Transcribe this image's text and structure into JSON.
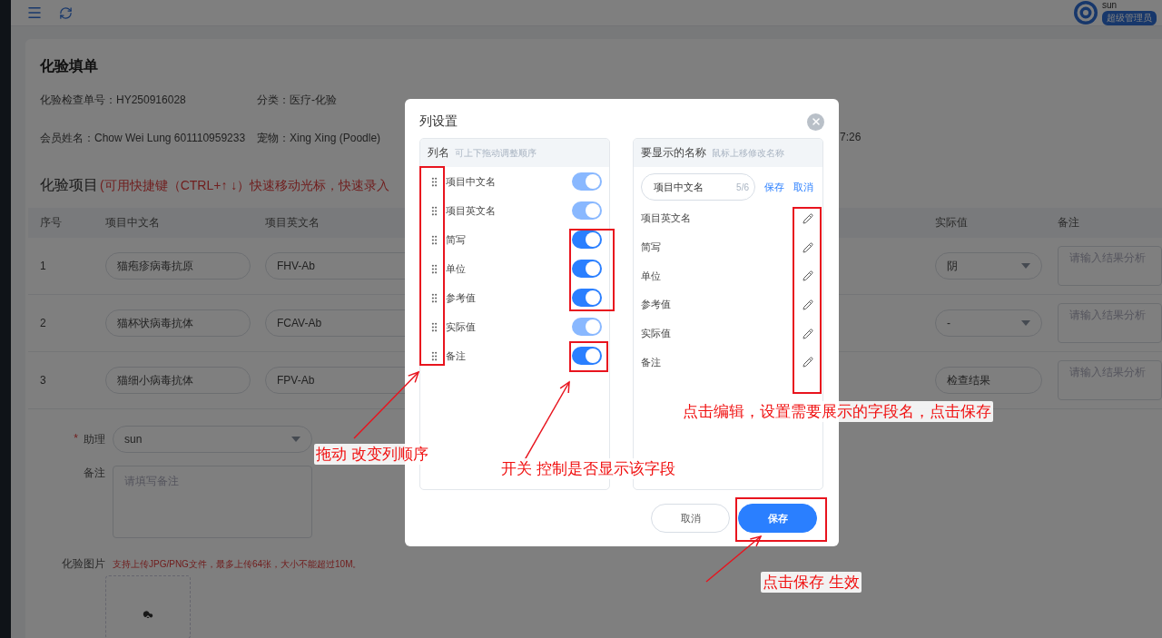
{
  "header": {
    "user_name": "sun",
    "role_badge": "超级管理员"
  },
  "form": {
    "title": "化验填单",
    "info_rows": [
      [
        "化验检查单号：HY250916028",
        "分类：医疗-化验"
      ],
      [
        "会员姓名：Chow Wei Lung 601110959233",
        "宠物：Xing Xing (Poodle)",
        "",
        "7:26"
      ]
    ],
    "section_title": "化验项目",
    "section_hint": "(可用快捷键（CTRL+↑ ↓）快速移动光标，快速录入",
    "table": {
      "columns": [
        "序号",
        "项目中文名",
        "项目英文名",
        "实际值",
        "备注"
      ],
      "rows": [
        {
          "index": "1",
          "name_cn": "猫疱疹病毒抗原",
          "name_en": "FHV-Ab",
          "actual": {
            "kind": "select",
            "value": "阴"
          },
          "remark_placeholder": "请输入结果分析"
        },
        {
          "index": "2",
          "name_cn": "猫杯状病毒抗体",
          "name_en": "FCAV-Ab",
          "actual": {
            "kind": "select",
            "value": "-"
          },
          "remark_placeholder": "请输入结果分析"
        },
        {
          "index": "3",
          "name_cn": "猫细小病毒抗体",
          "name_en": "FPV-Ab",
          "actual": {
            "kind": "input",
            "value": "检查结果"
          },
          "remark_placeholder": "请输入结果分析"
        }
      ]
    },
    "assistant": {
      "label": "助理",
      "required_mark": "*",
      "value": "sun"
    },
    "remark": {
      "label": "备注",
      "placeholder": "请填写备注"
    },
    "images": {
      "label": "化验图片",
      "hint": "支持上传JPG/PNG文件，最多上传64张，大小不能超过10M。"
    }
  },
  "modal": {
    "title": "列设置",
    "left_panel": {
      "title": "列名",
      "hint": "可上下拖动调整顺序",
      "columns": [
        {
          "label": "项目中文名",
          "on": true,
          "disabled": true
        },
        {
          "label": "项目英文名",
          "on": true,
          "disabled": true
        },
        {
          "label": "简写",
          "on": true,
          "disabled": false
        },
        {
          "label": "单位",
          "on": true,
          "disabled": false
        },
        {
          "label": "参考值",
          "on": true,
          "disabled": false
        },
        {
          "label": "实际值",
          "on": true,
          "disabled": true
        },
        {
          "label": "备注",
          "on": true,
          "disabled": false
        }
      ]
    },
    "right_panel": {
      "title": "要显示的名称",
      "hint": "鼠标上移修改名称",
      "editing": {
        "value": "项目中文名",
        "count": "5/6",
        "save": "保存",
        "cancel": "取消"
      },
      "names": [
        "项目英文名",
        "简写",
        "单位",
        "参考值",
        "实际值",
        "备注"
      ]
    },
    "buttons": [
      {
        "label": "取消",
        "primary": false
      },
      {
        "label": "保存",
        "primary": true
      }
    ]
  },
  "annotations": [
    "拖动 改变列顺序",
    "开关 控制是否显示该字段",
    "点击编辑，设置需要展示的字段名，点击保存",
    "点击保存 生效"
  ]
}
